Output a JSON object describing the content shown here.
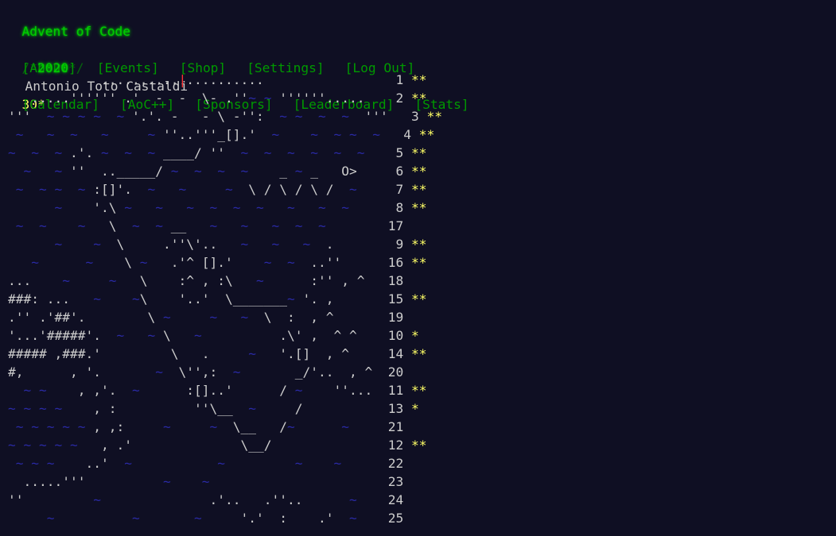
{
  "header": {
    "title": "Advent of Code",
    "nav_top": [
      "[About]",
      "[Events]",
      "[Shop]",
      "[Settings]",
      "[Log Out]"
    ],
    "user": "Antonio Toto Castaldi",
    "user_stars": "30*",
    "year_prefix": "/*",
    "year": "2020",
    "year_suffix": "*/",
    "nav_bottom": [
      "[Calendar]",
      "[AoC++]",
      "[Sponsors]",
      "[Leaderboard]",
      "[Stats]"
    ]
  },
  "calendar": [
    {
      "art": "            ..........|..........",
      "day": "1",
      "stars": "**"
    },
    {
      "art": "   .....'''''' .'  -  -  \\- .''~ ~ ''''''.....",
      "day": "2",
      "stars": "**"
    },
    {
      "art": "'''  ~ ~ ~ ~  ~ '.'. -   - \\ -'':  ~ ~  ~  ~  '''",
      "day": "3",
      "stars": "**"
    },
    {
      "art": " ~   ~  ~   ~     ~ ''..'''_[].'  ~    ~  ~ ~  ~",
      "day": "4",
      "stars": "**"
    },
    {
      "art": "~  ~  ~ .'. ~  ~  ~ ____/ ''  ~  ~  ~  ~  ~  ~",
      "day": "5",
      "stars": "**"
    },
    {
      "art": "  ~   ~ ''  .._____/ ~  ~  ~  ~    _ ~ _   O>",
      "day": "6",
      "stars": "**"
    },
    {
      "art": " ~  ~ ~  ~ :[]'.  ~   ~     ~  \\ / \\ / \\ /  ~",
      "day": "7",
      "stars": "**"
    },
    {
      "art": "      ~    '.\\ ~   ~   ~  ~  ~  ~   ~   ~  ~",
      "day": "8",
      "stars": "**"
    },
    {
      "art": " ~  ~    ~   \\  ~  ~ __   ~   ~   ~  ~  ~",
      "day": "17",
      "stars": ""
    },
    {
      "art": "      ~    ~  \\     .''\\'..   ~   ~   ~  .",
      "day": "9",
      "stars": "**"
    },
    {
      "art": "   ~      ~    \\ ~   .'^ [].'    ~  ~  ..''",
      "day": "16",
      "stars": "**"
    },
    {
      "art": "...    ~     ~   \\    :^ , :\\   ~      :'' , ^",
      "day": "18",
      "stars": ""
    },
    {
      "art": "###: ...   ~    ~\\    '..'  \\_______~ '. ,",
      "day": "15",
      "stars": "**"
    },
    {
      "art": ".'' .'##'.        \\ ~     ~   ~  \\  :  , ^",
      "day": "19",
      "stars": ""
    },
    {
      "art": "'...'#####'.  ~   ~ \\   ~          .\\' ,  ^ ^",
      "day": "10",
      "stars": "*"
    },
    {
      "art": "##### ,###.'         \\   .     ~   '.[]  , ^",
      "day": "14",
      "stars": "**"
    },
    {
      "art": "#,      , '.       ~  \\'',:  ~       _/'..  , ^",
      "day": "20",
      "stars": ""
    },
    {
      "art": "  ~ ~    , ,'.  ~      :[]..'      / ~    ''...",
      "day": "11",
      "stars": "**"
    },
    {
      "art": "~ ~ ~ ~    , :          ''\\__  ~     /",
      "day": "13",
      "stars": "*"
    },
    {
      "art": " ~ ~ ~ ~ ~ , ,:     ~     ~  \\__   /~      ~",
      "day": "21",
      "stars": ""
    },
    {
      "art": "~ ~ ~ ~ ~   , .'              \\__/",
      "day": "12",
      "stars": "**"
    },
    {
      "art": " ~ ~ ~    ..'  ~           ~         ~    ~",
      "day": "22",
      "stars": ""
    },
    {
      "art": "  .....'''          ~    ~",
      "day": "23",
      "stars": ""
    },
    {
      "art": "''         ~              .'..   .''..      ~",
      "day": "24",
      "stars": ""
    },
    {
      "art": "     ~          ~       ~     '.'  :    .'  ~",
      "day": "25",
      "stars": ""
    }
  ]
}
